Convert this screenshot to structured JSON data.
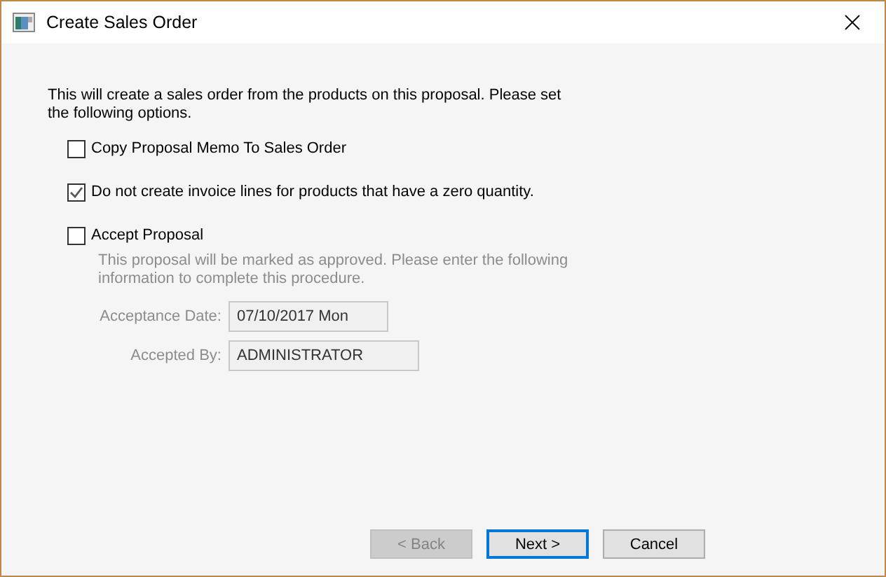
{
  "window": {
    "title": "Create Sales Order"
  },
  "intro": "This will create a sales order from the products on this proposal.  Please set the following options.",
  "options": [
    {
      "label": "Copy Proposal Memo To Sales Order",
      "checked": false
    },
    {
      "label": "Do not create invoice lines for products that have a zero quantity.",
      "checked": true
    },
    {
      "label": "Accept Proposal",
      "checked": false
    }
  ],
  "acceptance": {
    "disabled": true,
    "note": "This proposal will be marked as approved.  Please enter the following information to complete this procedure.",
    "fields": [
      {
        "label": "Acceptance Date:",
        "value": "07/10/2017 Mon"
      },
      {
        "label": "Accepted By:",
        "value": "ADMINISTRATOR"
      }
    ]
  },
  "buttons": [
    {
      "label": "< Back",
      "disabled": true,
      "default": false
    },
    {
      "label": "Next >",
      "disabled": false,
      "default": true
    },
    {
      "label": "Cancel",
      "disabled": false,
      "default": false
    }
  ]
}
